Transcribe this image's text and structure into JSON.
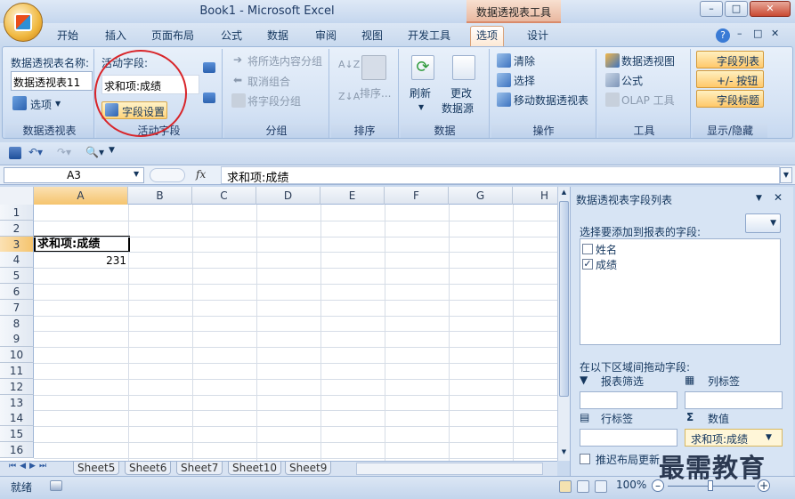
{
  "window": {
    "title": "Book1 - Microsoft Excel",
    "context_title": "数据透视表工具",
    "btn_min": "–",
    "btn_max": "□",
    "btn_close": "✕"
  },
  "tabs": [
    "开始",
    "插入",
    "页面布局",
    "公式",
    "数据",
    "审阅",
    "视图",
    "开发工具",
    "选项",
    "设计"
  ],
  "active_tab": "选项",
  "ribbon": {
    "pivot": {
      "label": "数据透视表名称:",
      "name_value": "数据透视表11",
      "options_label": "选项",
      "group_name": "数据透视表"
    },
    "active_field": {
      "label": "活动字段:",
      "field_value": "求和项:成绩",
      "settings_label": "字段设置",
      "group_name": "活动字段"
    },
    "group": {
      "items": [
        "将所选内容分组",
        "取消组合",
        "将字段分组"
      ],
      "group_name": "分组"
    },
    "sort": {
      "sort_label": "排序...",
      "group_name": "排序"
    },
    "data": {
      "refresh_label": "刷新",
      "change_label": "更改",
      "change_label2": "数据源",
      "group_name": "数据"
    },
    "actions": {
      "items": [
        "清除",
        "选择",
        "移动数据透视表"
      ],
      "group_name": "操作"
    },
    "tools": {
      "items": [
        "数据透视图",
        "公式",
        "OLAP 工具"
      ],
      "group_name": "工具"
    },
    "show": {
      "items": [
        "字段列表",
        "+/- 按钮",
        "字段标题"
      ],
      "group_name": "显示/隐藏"
    }
  },
  "formula": {
    "cell_ref": "A3",
    "fx": "fx",
    "content": "求和项:成绩"
  },
  "grid": {
    "columns": [
      "A",
      "B",
      "C",
      "D",
      "E",
      "F",
      "G",
      "H"
    ],
    "rows": [
      "1",
      "2",
      "3",
      "4",
      "5",
      "6",
      "7",
      "8",
      "9",
      "10",
      "11",
      "12",
      "13",
      "14",
      "15",
      "16"
    ],
    "a3": "求和项:成绩",
    "a4": "231"
  },
  "sheets": [
    "Sheet5",
    "Sheet6",
    "Sheet7",
    "Sheet10",
    "Sheet9"
  ],
  "status": {
    "ready": "就绪",
    "zoom": "100%"
  },
  "field_list": {
    "title": "数据透视表字段列表",
    "choose_label": "选择要添加到报表的字段:",
    "fields": [
      {
        "name": "姓名",
        "checked": false
      },
      {
        "name": "成绩",
        "checked": true
      }
    ],
    "drag_label": "在以下区域间拖动字段:",
    "report_filter": "报表筛选",
    "column_labels": "列标签",
    "row_labels": "行标签",
    "values": "数值",
    "value_item": "求和项:成绩",
    "defer_label": "推迟布局更新"
  },
  "watermark": "最需教育"
}
